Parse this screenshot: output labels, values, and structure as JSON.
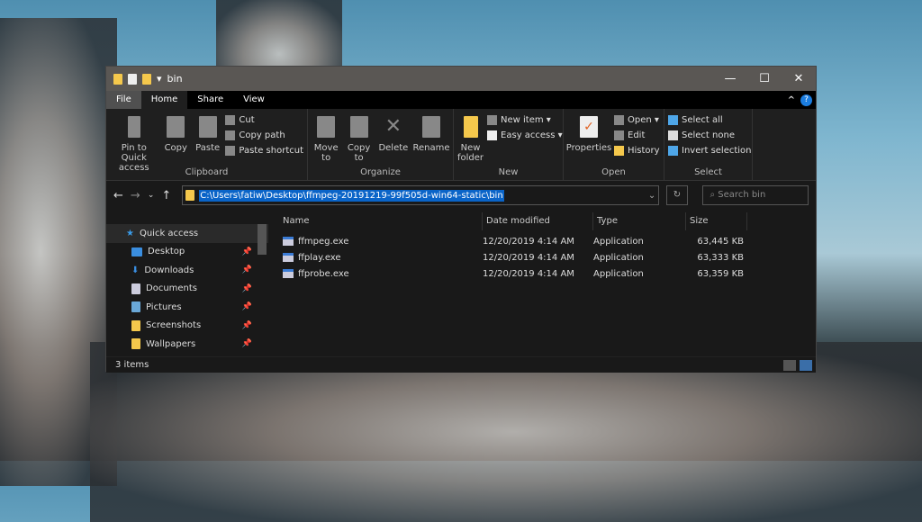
{
  "window": {
    "title": "bin",
    "controls": [
      "—",
      "☐",
      "✕"
    ]
  },
  "tabs": [
    {
      "label": "File"
    },
    {
      "label": "Home"
    },
    {
      "label": "Share"
    },
    {
      "label": "View"
    }
  ],
  "ribbon": {
    "clipboard": {
      "label": "Clipboard",
      "pin": "Pin to Quick access",
      "copy": "Copy",
      "paste": "Paste",
      "cut": "Cut",
      "copy_path": "Copy path",
      "paste_shortcut": "Paste shortcut"
    },
    "organize": {
      "label": "Organize",
      "move_to": "Move to",
      "copy_to": "Copy to",
      "delete": "Delete",
      "rename": "Rename"
    },
    "new": {
      "label": "New",
      "new_folder": "New folder",
      "new_item": "New item ▾",
      "easy_access": "Easy access ▾"
    },
    "open": {
      "label": "Open",
      "properties": "Properties",
      "open": "Open ▾",
      "edit": "Edit",
      "history": "History"
    },
    "select": {
      "label": "Select",
      "select_all": "Select all",
      "select_none": "Select none",
      "invert": "Invert selection"
    }
  },
  "address": {
    "path": "C:\\Users\\fatiw\\Desktop\\ffmpeg-20191219-99f505d-win64-static\\bin",
    "search_placeholder": "Search bin"
  },
  "sidebar": {
    "items": [
      {
        "label": "Quick access"
      },
      {
        "label": "Desktop"
      },
      {
        "label": "Downloads"
      },
      {
        "label": "Documents"
      },
      {
        "label": "Pictures"
      },
      {
        "label": "Screenshots"
      },
      {
        "label": "Wallpapers"
      }
    ]
  },
  "columns": [
    "Name",
    "Date modified",
    "Type",
    "Size"
  ],
  "files": [
    {
      "name": "ffmpeg.exe",
      "date": "12/20/2019 4:14 AM",
      "type": "Application",
      "size": "63,445 KB"
    },
    {
      "name": "ffplay.exe",
      "date": "12/20/2019 4:14 AM",
      "type": "Application",
      "size": "63,333 KB"
    },
    {
      "name": "ffprobe.exe",
      "date": "12/20/2019 4:14 AM",
      "type": "Application",
      "size": "63,359 KB"
    }
  ],
  "status": {
    "count": "3 items"
  },
  "colors": {
    "selection": "#0a64c8",
    "titlebar": "#5a5754"
  }
}
